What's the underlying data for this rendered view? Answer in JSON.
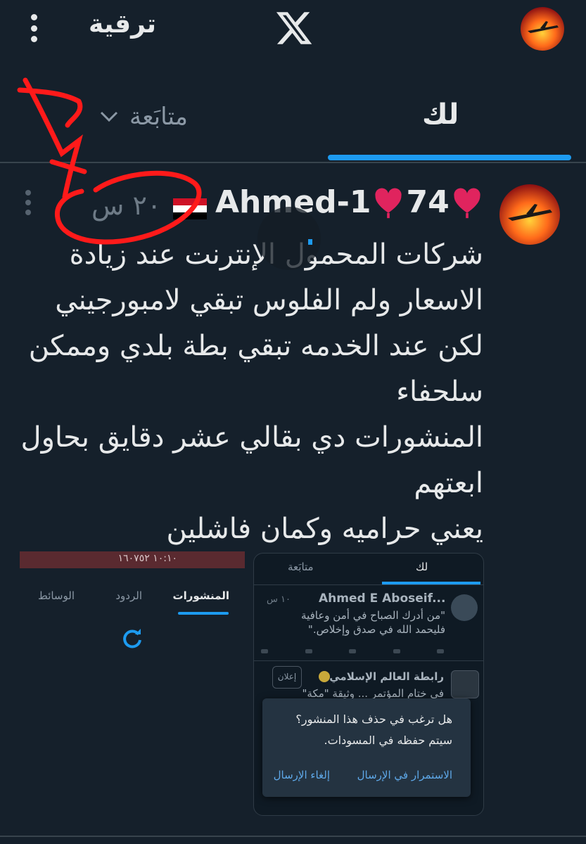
{
  "header": {
    "upgrade_label": "ترقية",
    "logo_icon": "x-logo-icon",
    "menu_icon": "vertical-dots-icon"
  },
  "tabs": {
    "for_you": "لك",
    "following": "متابَعة"
  },
  "post": {
    "username": "Ahmed-1",
    "username_suffix": "74",
    "time": "٢٠ س",
    "flag": "egypt-flag",
    "text_lines": [
      "شركات المحمول الإنترنت عند زيادة",
      "الاسعار ولم الفلوس تبقي لامبورجيني",
      "لكن عند الخدمه تبقي بطة بلدي وممكن",
      "سلحفاء",
      "المنشورات دي بقالي عشر دقايق بحاول",
      "ابعتهم",
      "يعني حراميه وكمان فاشلين"
    ]
  },
  "left_embed": {
    "strip_text": "١٠:١٠ ١٦٠٧٥٢",
    "tabs": [
      "المنشورات",
      "الردود",
      "الوسائط"
    ]
  },
  "embed": {
    "tab_for_you": "لك",
    "tab_following": "متابَعة",
    "post1_name": "Ahmed E Aboseif...",
    "post1_time": "١٠ س",
    "post1_text": "\"من أدرك الصباح في أمن وعافية فليحمد الله في صدق وإخلاص.\"",
    "post2_name": "رابطة العالم الإسلامي",
    "post2_ad": "إعلان",
    "post2_text": "في ختام المؤتمر ... وثيقة \"مكة\""
  },
  "dialog": {
    "line1": "هل ترغب في حذف هذا المنشور؟",
    "line2": "سيتم حفظه في المسودات.",
    "continue": "الاستمرار في الإرسال",
    "cancel": "إلغاء الإرسال"
  },
  "colors": {
    "background": "#15202b",
    "accent": "#1d9bf0",
    "annotation": "#ff1a1a"
  }
}
